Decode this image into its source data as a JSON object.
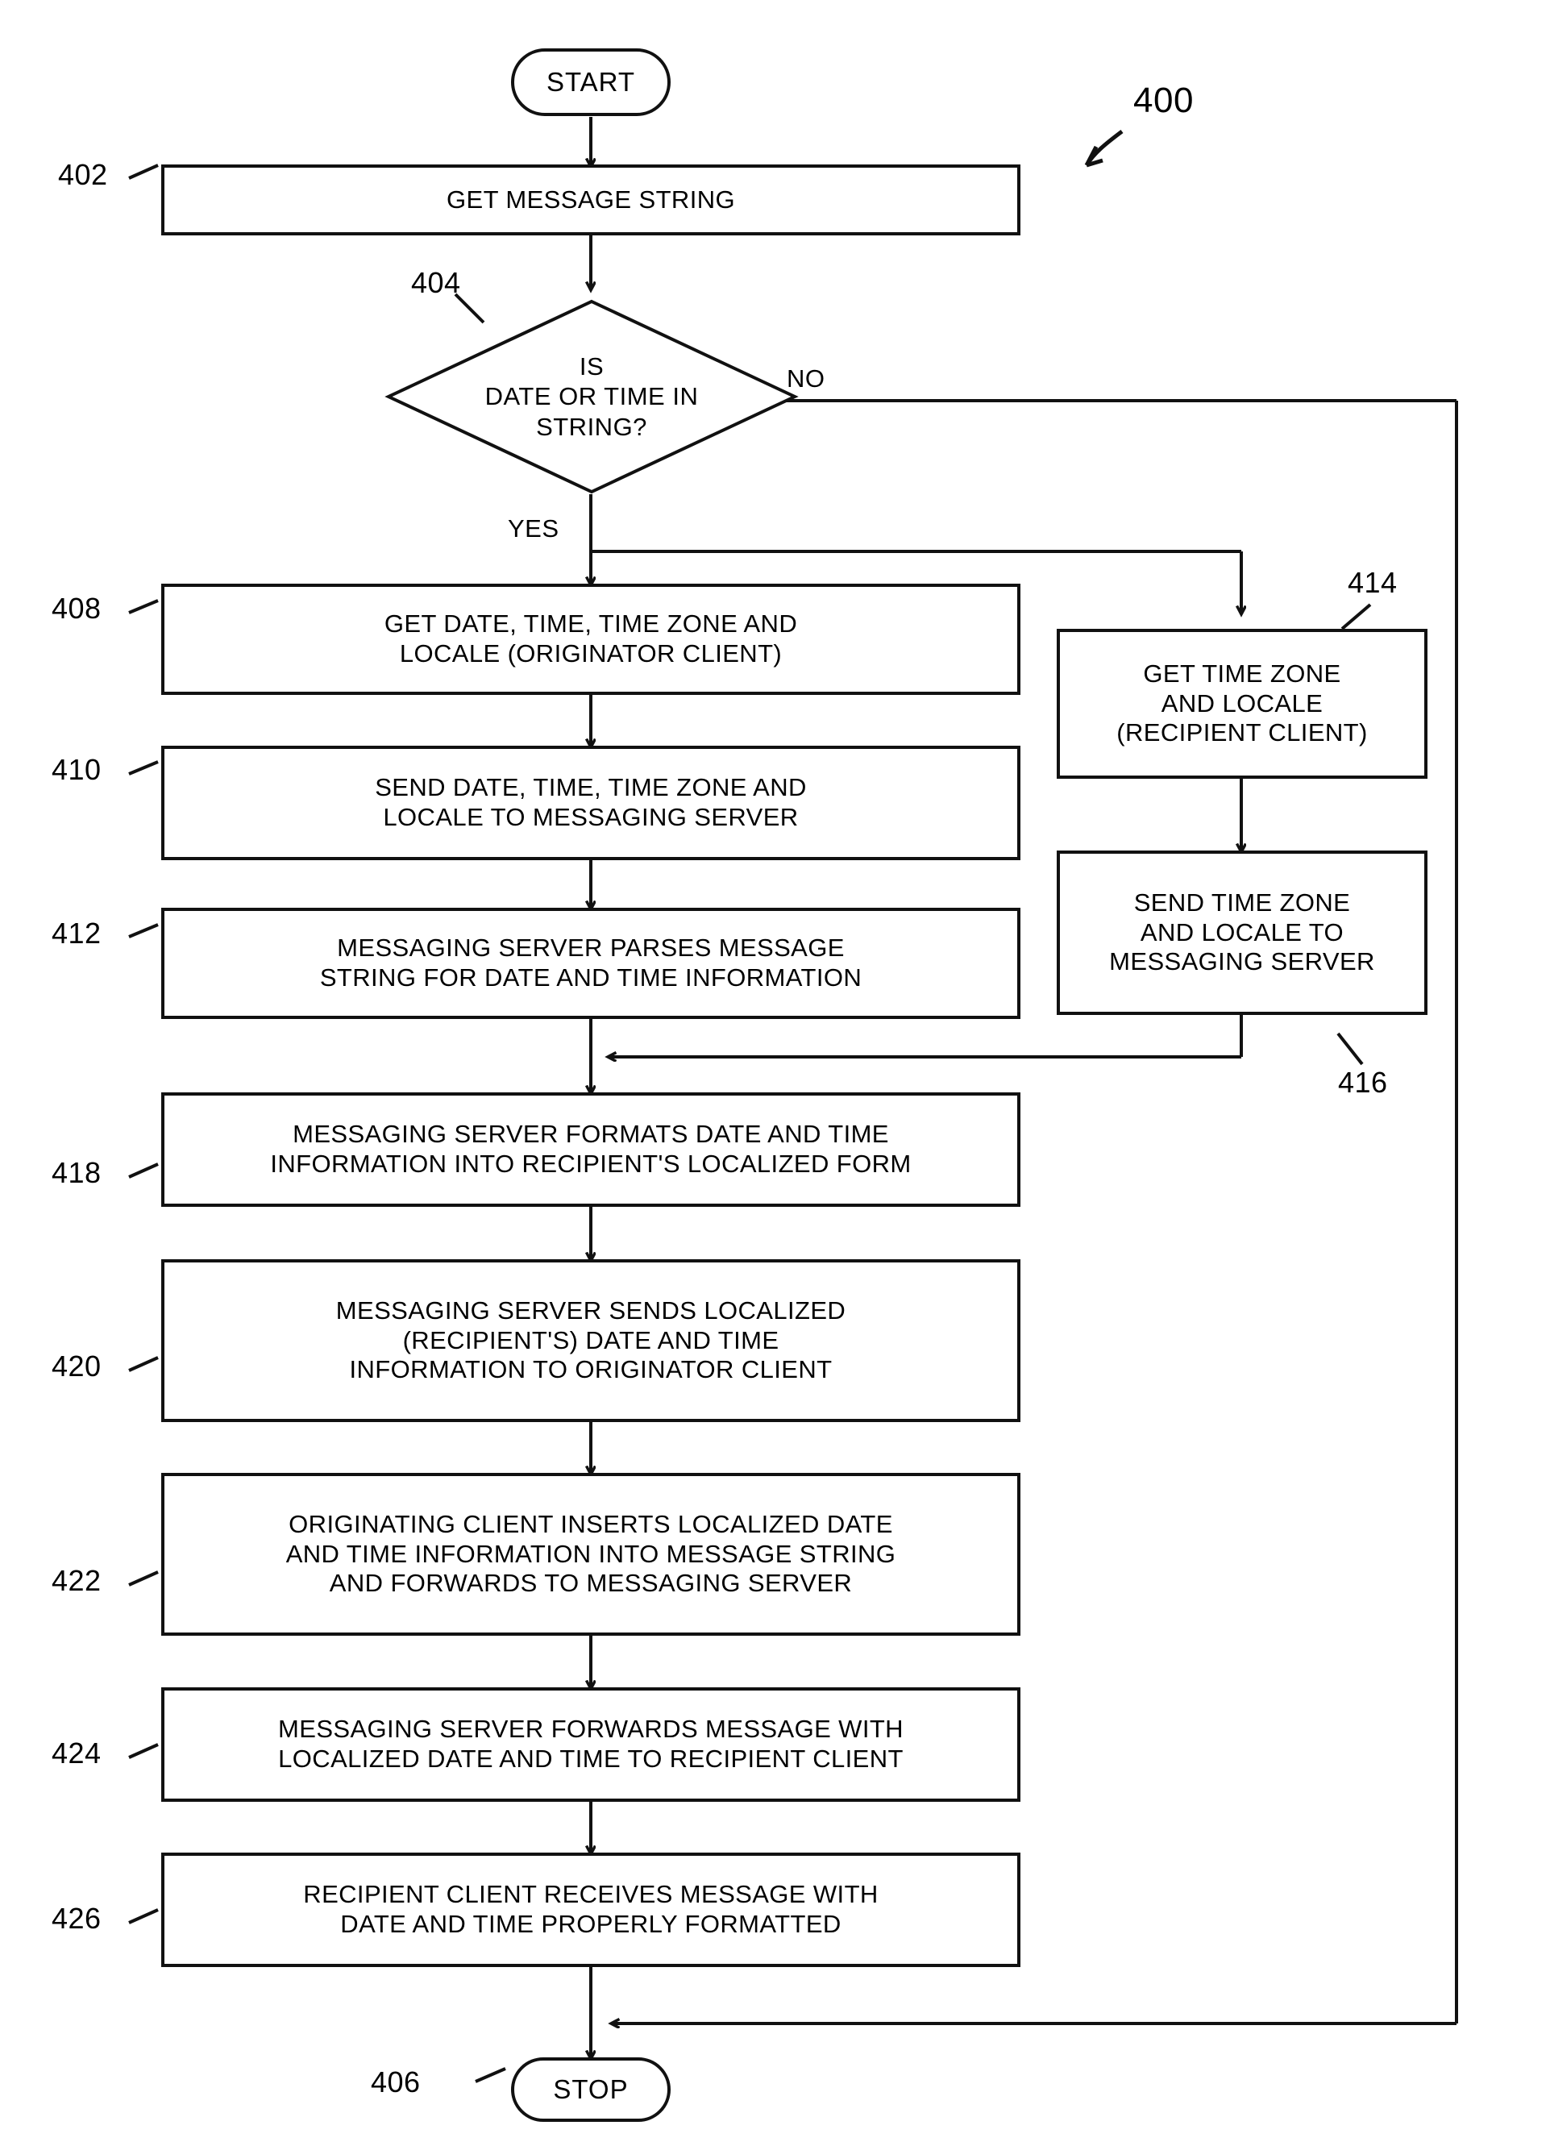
{
  "figure": {
    "number": "400",
    "type": "flowchart"
  },
  "nodes": {
    "start": {
      "label": "START",
      "ref": ""
    },
    "get_message_string": {
      "label": "GET MESSAGE STRING",
      "ref": "402"
    },
    "decision": {
      "label": "IS\nDATE OR TIME IN\nSTRING?",
      "ref": "404",
      "yes": "YES",
      "no": "NO"
    },
    "get_date_time": {
      "label": "GET DATE, TIME, TIME ZONE AND\nLOCALE (ORIGINATOR CLIENT)",
      "ref": "408"
    },
    "send_date_time": {
      "label": "SEND DATE, TIME, TIME ZONE AND\nLOCALE TO MESSAGING SERVER",
      "ref": "410"
    },
    "server_parses": {
      "label": "MESSAGING SERVER PARSES MESSAGE\nSTRING FOR DATE AND TIME INFORMATION",
      "ref": "412"
    },
    "get_time_zone": {
      "label": "GET TIME ZONE\nAND LOCALE\n(RECIPIENT CLIENT)",
      "ref": "414"
    },
    "send_time_zone": {
      "label": "SEND TIME ZONE\nAND LOCALE TO\nMESSAGING SERVER",
      "ref": "416"
    },
    "server_formats": {
      "label": "MESSAGING SERVER FORMATS DATE AND TIME\nINFORMATION INTO RECIPIENT'S LOCALIZED FORM",
      "ref": "418"
    },
    "server_sends": {
      "label": "MESSAGING SERVER SENDS LOCALIZED\n(RECIPIENT'S) DATE AND TIME\nINFORMATION TO ORIGINATOR CLIENT",
      "ref": "420"
    },
    "originating_inserts": {
      "label": "ORIGINATING CLIENT INSERTS LOCALIZED DATE\nAND TIME INFORMATION INTO MESSAGE STRING\nAND FORWARDS TO MESSAGING SERVER",
      "ref": "422"
    },
    "server_forwards": {
      "label": "MESSAGING SERVER FORWARDS MESSAGE WITH\nLOCALIZED DATE AND TIME TO RECIPIENT CLIENT",
      "ref": "424"
    },
    "recipient_receives": {
      "label": "RECIPIENT CLIENT RECEIVES MESSAGE WITH\nDATE AND TIME PROPERLY FORMATTED",
      "ref": "426"
    },
    "stop": {
      "label": "STOP",
      "ref": "406"
    }
  }
}
